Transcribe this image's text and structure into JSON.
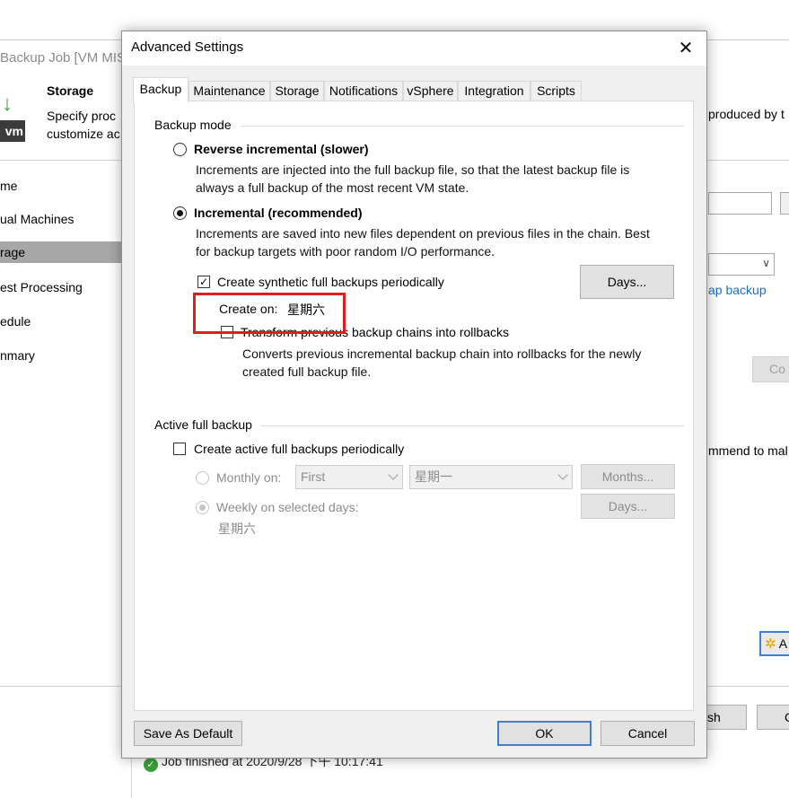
{
  "background_window": {
    "title": "Backup Job [VM MIS",
    "header": {
      "icon_label": "vm",
      "title": "Storage",
      "desc_line1": "Specify proc",
      "desc_line2": "customize ac",
      "desc_right": "produced by t"
    },
    "sidebar": [
      "me",
      "ual Machines",
      "rage",
      "est Processing",
      "edule",
      "nmary"
    ],
    "link_text": "ap backup",
    "con_button": "Co",
    "recommend_text": "mmend to mal",
    "advanced_button": "A",
    "finish_button": "sh",
    "cancel_button": "C",
    "status": "Job finished at 2020/9/28 下午 10:17:41"
  },
  "dialog": {
    "title": "Advanced Settings",
    "close_glyph": "✕",
    "tabs": [
      "Backup",
      "Maintenance",
      "Storage",
      "Notifications",
      "vSphere",
      "Integration",
      "Scripts"
    ],
    "active_tab": "Backup",
    "backup_mode": {
      "group_title": "Backup mode",
      "reverse": {
        "label": "Reverse incremental (slower)",
        "checked": false,
        "desc_line1": "Increments are injected into the full backup file, so that the latest backup file is",
        "desc_line2": "always a full backup of the most recent VM state."
      },
      "incremental": {
        "label": "Incremental (recommended)",
        "checked": true,
        "desc_line1": "Increments are saved into new files dependent on previous files in the chain. Best",
        "desc_line2": "for backup targets with poor random I/O performance."
      },
      "synthetic": {
        "label": "Create synthetic full backups periodically",
        "checked": true,
        "days_button": "Days...",
        "create_on_label": "Create on:",
        "create_on_value": "星期六"
      },
      "transform": {
        "label": "Transform previous backup chains into rollbacks",
        "checked": false,
        "desc_line1": "Converts previous incremental backup chain into rollbacks for the newly",
        "desc_line2": "created full backup file."
      }
    },
    "active_full": {
      "group_title": "Active full backup",
      "checkbox_label": "Create active full backups periodically",
      "checked": false,
      "monthly": {
        "label": "Monthly on:",
        "checked": false,
        "week_value": "First",
        "day_value": "星期一",
        "button": "Months..."
      },
      "weekly": {
        "label": "Weekly on selected days:",
        "checked": true,
        "button": "Days...",
        "selected_days": "星期六"
      }
    },
    "footer": {
      "save_default": "Save As Default",
      "ok": "OK",
      "cancel": "Cancel"
    }
  },
  "colors": {
    "highlight_border": "#e01c1c",
    "focus_border": "#3d7fd0",
    "link": "#1a6fc4"
  }
}
